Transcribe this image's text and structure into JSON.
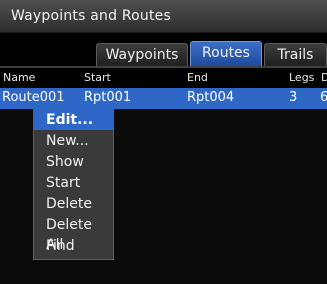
{
  "window": {
    "title": "Waypoints and Routes"
  },
  "tabs": [
    {
      "label": "Waypoints",
      "active": false
    },
    {
      "label": "Routes",
      "active": true
    },
    {
      "label": "Trails",
      "active": false
    }
  ],
  "table": {
    "headers": [
      "Name",
      "Start",
      "End",
      "Legs",
      "D"
    ],
    "rows": [
      {
        "name": "Route001",
        "start": "Rpt001",
        "end": "Rpt004",
        "legs": "3",
        "extra": "6"
      }
    ]
  },
  "context_menu": {
    "items": [
      "Edit...",
      "New...",
      "Show",
      "Start",
      "Delete",
      "Delete All",
      "Find"
    ],
    "selected": "Edit..."
  },
  "colors": {
    "accent": "#2f67c6",
    "titlebar": "#3b3b3b",
    "menu_bg": "#3a3a3a",
    "background": "#000000"
  }
}
